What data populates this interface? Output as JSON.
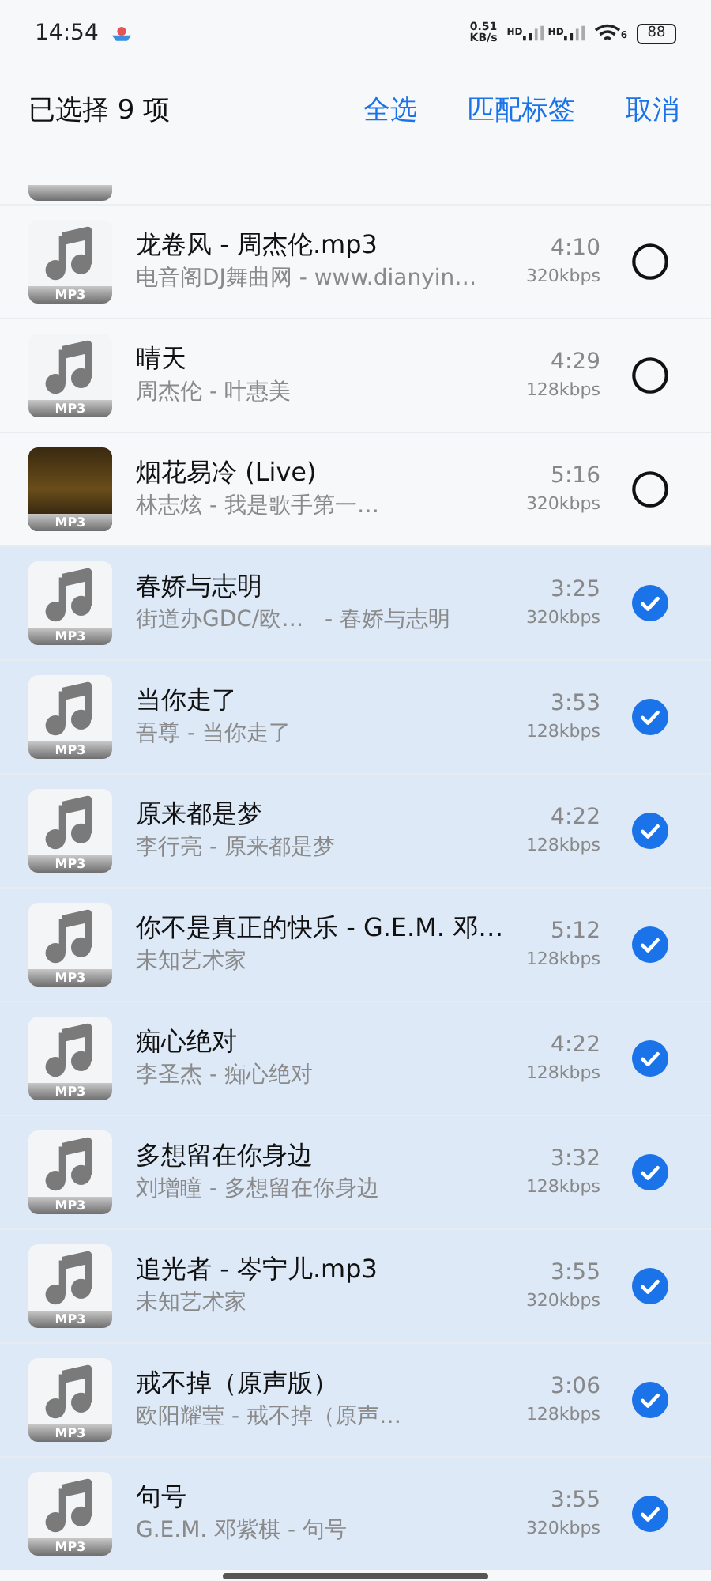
{
  "status_bar": {
    "time": "14:54",
    "net_speed": [
      "0.51",
      "KB/s"
    ],
    "sim_labels": [
      "HD",
      "HD"
    ],
    "wifi_label": "6",
    "battery": "88"
  },
  "header": {
    "title": "已选择 9 项",
    "actions": [
      "全选",
      "匹配标签",
      "取消"
    ]
  },
  "songs": [
    {
      "kind": "note",
      "title": "龙卷风 - 周杰伦.mp3",
      "subtitle": "电音阁DJ舞曲网 - www.dianyin…",
      "duration": "4:10",
      "bitrate": "320kbps",
      "badge": "MP3",
      "selected": false
    },
    {
      "kind": "note",
      "title": "晴天",
      "subtitle": "周杰伦 - 叶惠美",
      "duration": "4:29",
      "bitrate": "128kbps",
      "badge": "MP3",
      "selected": false
    },
    {
      "kind": "art",
      "title": "烟花易冷 (Live)",
      "subtitle": "林志炫 - 我是歌手第一…",
      "duration": "5:16",
      "bitrate": "320kbps",
      "badge": "MP3",
      "selected": false
    },
    {
      "kind": "note",
      "title": "春娇与志明",
      "subtitle": "街道办GDC/欧…   - 春娇与志明",
      "duration": "3:25",
      "bitrate": "320kbps",
      "badge": "MP3",
      "selected": true
    },
    {
      "kind": "note",
      "title": "当你走了",
      "subtitle": "吾尊 - 当你走了",
      "duration": "3:53",
      "bitrate": "128kbps",
      "badge": "MP3",
      "selected": true
    },
    {
      "kind": "note",
      "title": "原来都是梦",
      "subtitle": "李行亮 - 原来都是梦",
      "duration": "4:22",
      "bitrate": "128kbps",
      "badge": "MP3",
      "selected": true
    },
    {
      "kind": "note",
      "title": "你不是真正的快乐 - G.E.M. 邓…",
      "subtitle": "未知艺术家",
      "duration": "5:12",
      "bitrate": "128kbps",
      "badge": "MP3",
      "selected": true
    },
    {
      "kind": "note",
      "title": "痴心绝对",
      "subtitle": "李圣杰 - 痴心绝对",
      "duration": "4:22",
      "bitrate": "128kbps",
      "badge": "MP3",
      "selected": true
    },
    {
      "kind": "note",
      "title": "多想留在你身边",
      "subtitle": "刘增瞳 - 多想留在你身边",
      "duration": "3:32",
      "bitrate": "128kbps",
      "badge": "MP3",
      "selected": true
    },
    {
      "kind": "note",
      "title": "追光者 - 岑宁儿.mp3",
      "subtitle": "未知艺术家",
      "duration": "3:55",
      "bitrate": "320kbps",
      "badge": "MP3",
      "selected": true
    },
    {
      "kind": "note",
      "title": "戒不掉（原声版）",
      "subtitle": "欧阳耀莹 - 戒不掉（原声…",
      "duration": "3:06",
      "bitrate": "128kbps",
      "badge": "MP3",
      "selected": true
    },
    {
      "kind": "note",
      "title": "句号",
      "subtitle": "G.E.M. 邓紫棋 - 句号",
      "duration": "3:55",
      "bitrate": "320kbps",
      "badge": "MP3",
      "selected": true
    }
  ]
}
